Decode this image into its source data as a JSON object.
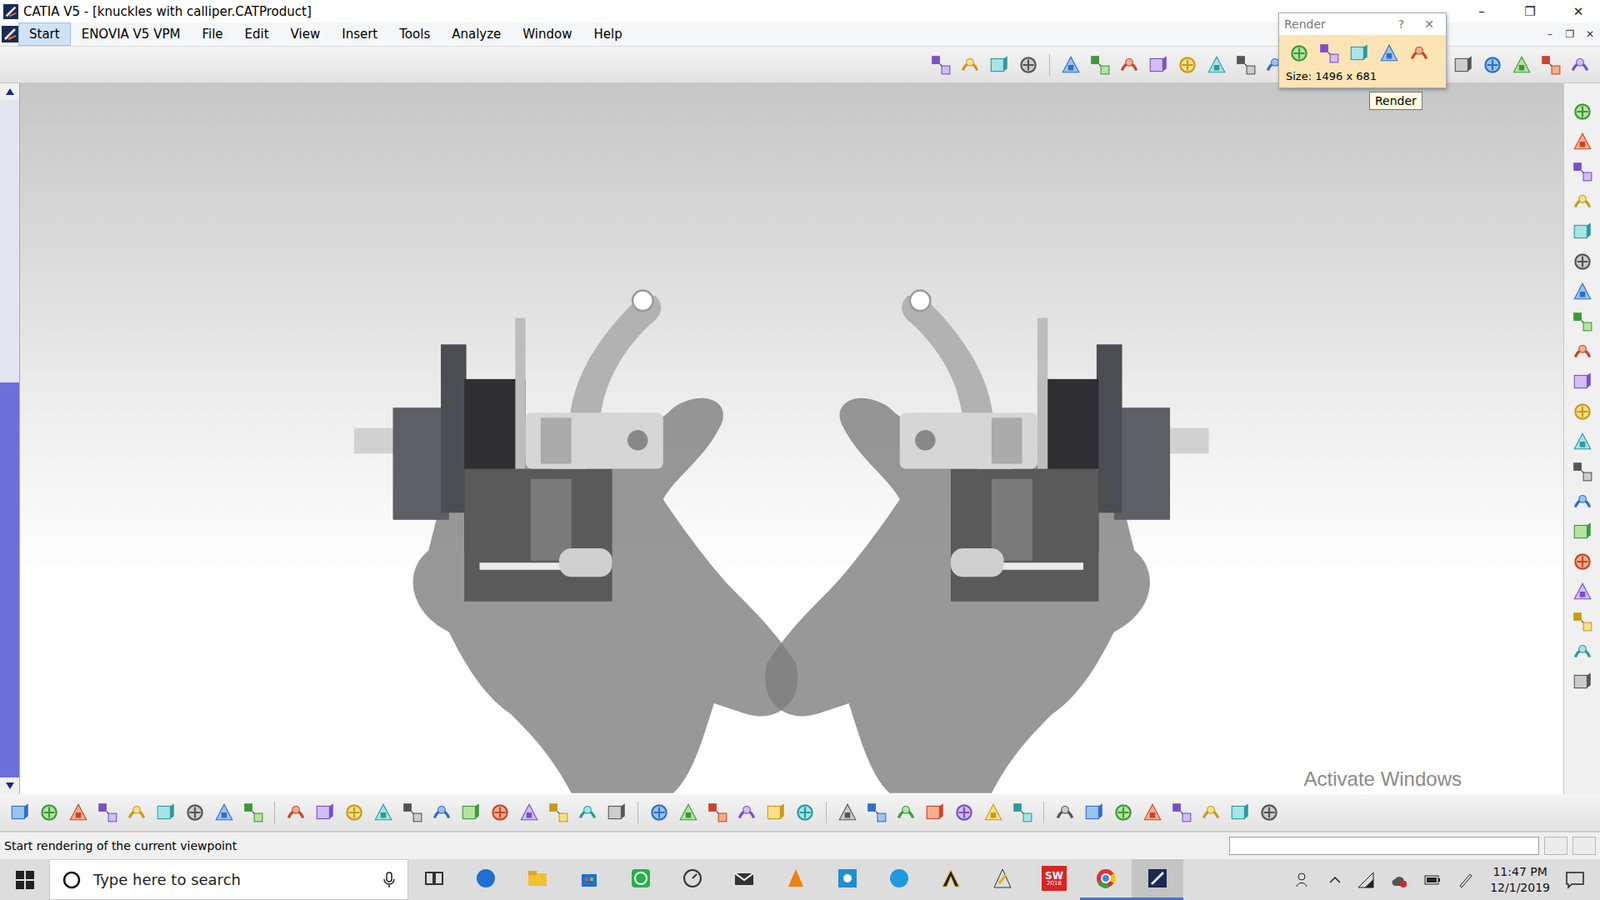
{
  "window": {
    "title": "CATIA V5 - [knuckles with calliper.CATProduct]",
    "controls": [
      "–",
      "❐",
      "✕"
    ]
  },
  "menu": {
    "items": [
      {
        "label": "Start",
        "selected": true
      },
      {
        "label": "ENOVIA V5 VPM",
        "selected": false
      },
      {
        "label": "File",
        "selected": false
      },
      {
        "label": "Edit",
        "selected": false
      },
      {
        "label": "View",
        "selected": false
      },
      {
        "label": "Insert",
        "selected": false
      },
      {
        "label": "Tools",
        "selected": false
      },
      {
        "label": "Analyze",
        "selected": false
      },
      {
        "label": "Window",
        "selected": false
      },
      {
        "label": "Help",
        "selected": false
      }
    ],
    "doc_controls": [
      "–",
      "❐",
      "✕"
    ]
  },
  "render_dialog": {
    "title": "Render",
    "help": "?",
    "close": "✕",
    "size": "Size: 1496 x 681",
    "tooltip": "Render"
  },
  "watermark": "Activate Windows",
  "status_bar": {
    "message": "Start rendering of the current viewpoint"
  },
  "taskbar": {
    "search_placeholder": "Type here to search",
    "apps": [
      {
        "kind": "taskview",
        "running": false,
        "selected": false
      },
      {
        "kind": "edge",
        "running": false,
        "selected": false
      },
      {
        "kind": "explorer",
        "running": false,
        "selected": false
      },
      {
        "kind": "store",
        "running": false,
        "selected": false
      },
      {
        "kind": "whatsapp",
        "running": false,
        "selected": false
      },
      {
        "kind": "speed",
        "running": false,
        "selected": false
      },
      {
        "kind": "mail",
        "running": false,
        "selected": false
      },
      {
        "kind": "vlc",
        "running": false,
        "selected": false
      },
      {
        "kind": "photo",
        "running": false,
        "selected": false
      },
      {
        "kind": "skype",
        "running": false,
        "selected": false
      },
      {
        "kind": "autodesk",
        "running": false,
        "selected": false
      },
      {
        "kind": "ansys",
        "running": false,
        "selected": false
      },
      {
        "kind": "solidworks",
        "running": false,
        "selected": false,
        "label": "SW",
        "sublabel": "2018"
      },
      {
        "kind": "chrome",
        "running": true,
        "selected": false
      },
      {
        "kind": "catia",
        "running": true,
        "selected": true
      }
    ],
    "time": "11:47 PM",
    "date": "12/1/2019"
  }
}
